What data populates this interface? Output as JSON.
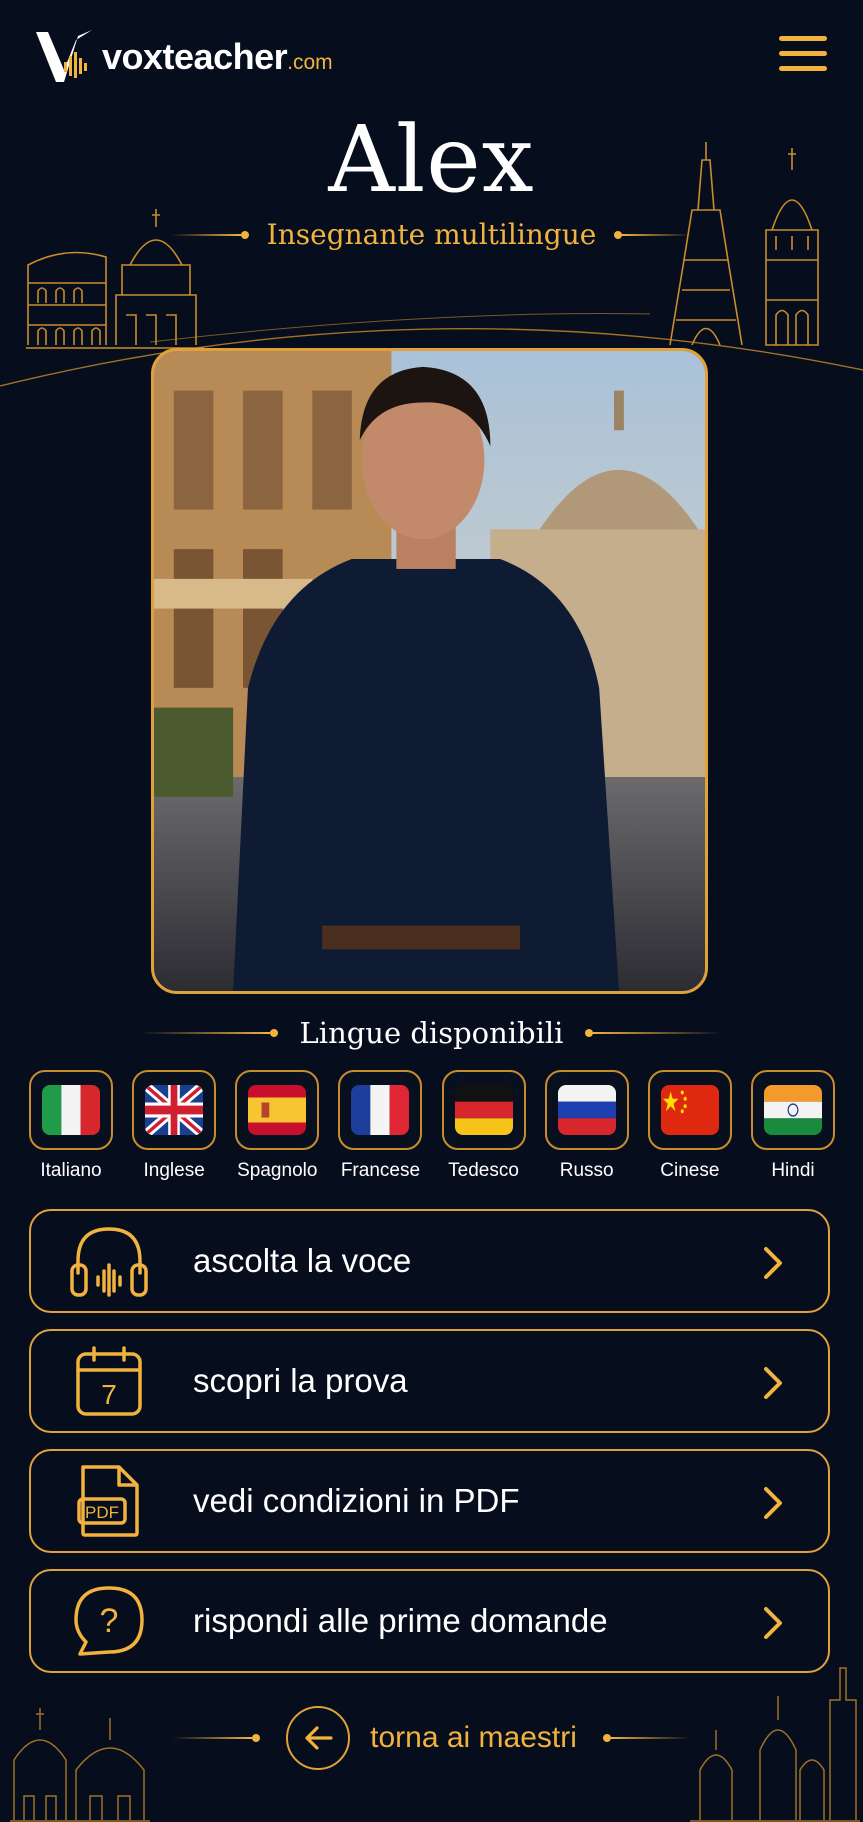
{
  "brand": {
    "name": "voxteacher",
    "tld": ".com",
    "gold": "#f2b23e",
    "background": "#060d1c"
  },
  "header": {
    "menu_icon": "hamburger-menu-icon"
  },
  "teacher": {
    "name": "Alex",
    "subtitle": "Insegnante multilingue"
  },
  "languages": {
    "title": "Lingue disponibili",
    "items": [
      {
        "label": "Italiano",
        "flag": "italy"
      },
      {
        "label": "Inglese",
        "flag": "uk"
      },
      {
        "label": "Spagnolo",
        "flag": "spain"
      },
      {
        "label": "Francese",
        "flag": "france"
      },
      {
        "label": "Tedesco",
        "flag": "germany"
      },
      {
        "label": "Russo",
        "flag": "russia"
      },
      {
        "label": "Cinese",
        "flag": "china"
      },
      {
        "label": "Hindi",
        "flag": "india"
      }
    ]
  },
  "actions": [
    {
      "label": "ascolta la voce",
      "icon": "headphones-icon"
    },
    {
      "label": "scopri la prova",
      "icon": "calendar-icon",
      "icon_text": "7"
    },
    {
      "label": "vedi condizioni in PDF",
      "icon": "pdf-document-icon",
      "icon_text": "PDF"
    },
    {
      "label": "rispondi alle prime domande",
      "icon": "question-bubble-icon",
      "icon_text": "?"
    }
  ],
  "footer": {
    "back_label": "torna ai maestri",
    "back_icon": "arrow-left-icon"
  }
}
